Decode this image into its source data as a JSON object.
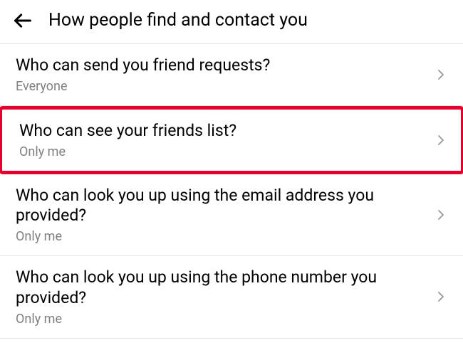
{
  "header": {
    "title": "How people find and contact you"
  },
  "rows": [
    {
      "label": "Who can send you friend requests?",
      "value": "Everyone"
    },
    {
      "label": "Who can see your friends list?",
      "value": "Only me"
    },
    {
      "label": "Who can look you up using the email address you provided?",
      "value": "Only me"
    },
    {
      "label": "Who can look you up using the phone number you provided?",
      "value": "Only me"
    }
  ],
  "highlighted_index": 1
}
